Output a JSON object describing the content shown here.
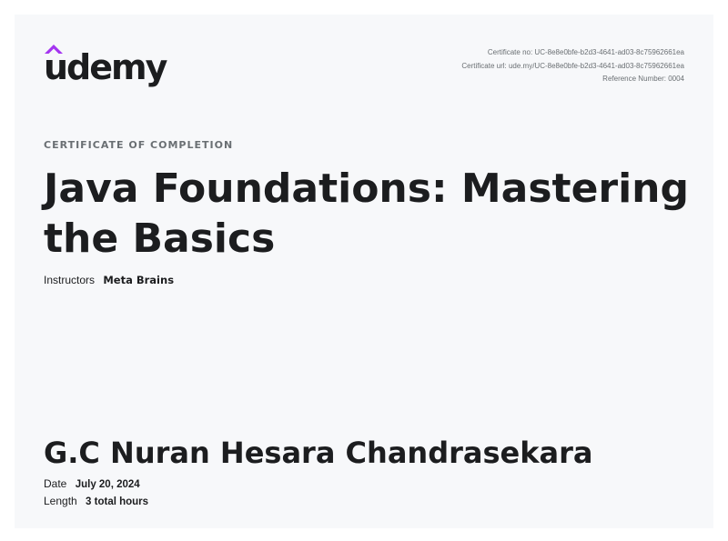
{
  "logo": {
    "wordmark": "udemy",
    "icon": "udemy-logo-icon",
    "accent_color": "#a435f0"
  },
  "meta": {
    "certificate_no": "Certificate no: UC-8e8e0bfe-b2d3-4641-ad03-8c75962661ea",
    "certificate_url": "Certificate url: ude.my/UC-8e8e0bfe-b2d3-4641-ad03-8c75962661ea",
    "reference_number": "Reference Number: 0004"
  },
  "certificate": {
    "eyebrow": "CERTIFICATE OF COMPLETION",
    "course_title": "Java Foundations: Mastering the Basics",
    "instructors_label": "Instructors",
    "instructors_value": "Meta Brains",
    "recipient_name": "G.C Nuran Hesara Chandrasekara",
    "date_label": "Date",
    "date_value": "July 20, 2024",
    "length_label": "Length",
    "length_value": "3 total hours"
  }
}
